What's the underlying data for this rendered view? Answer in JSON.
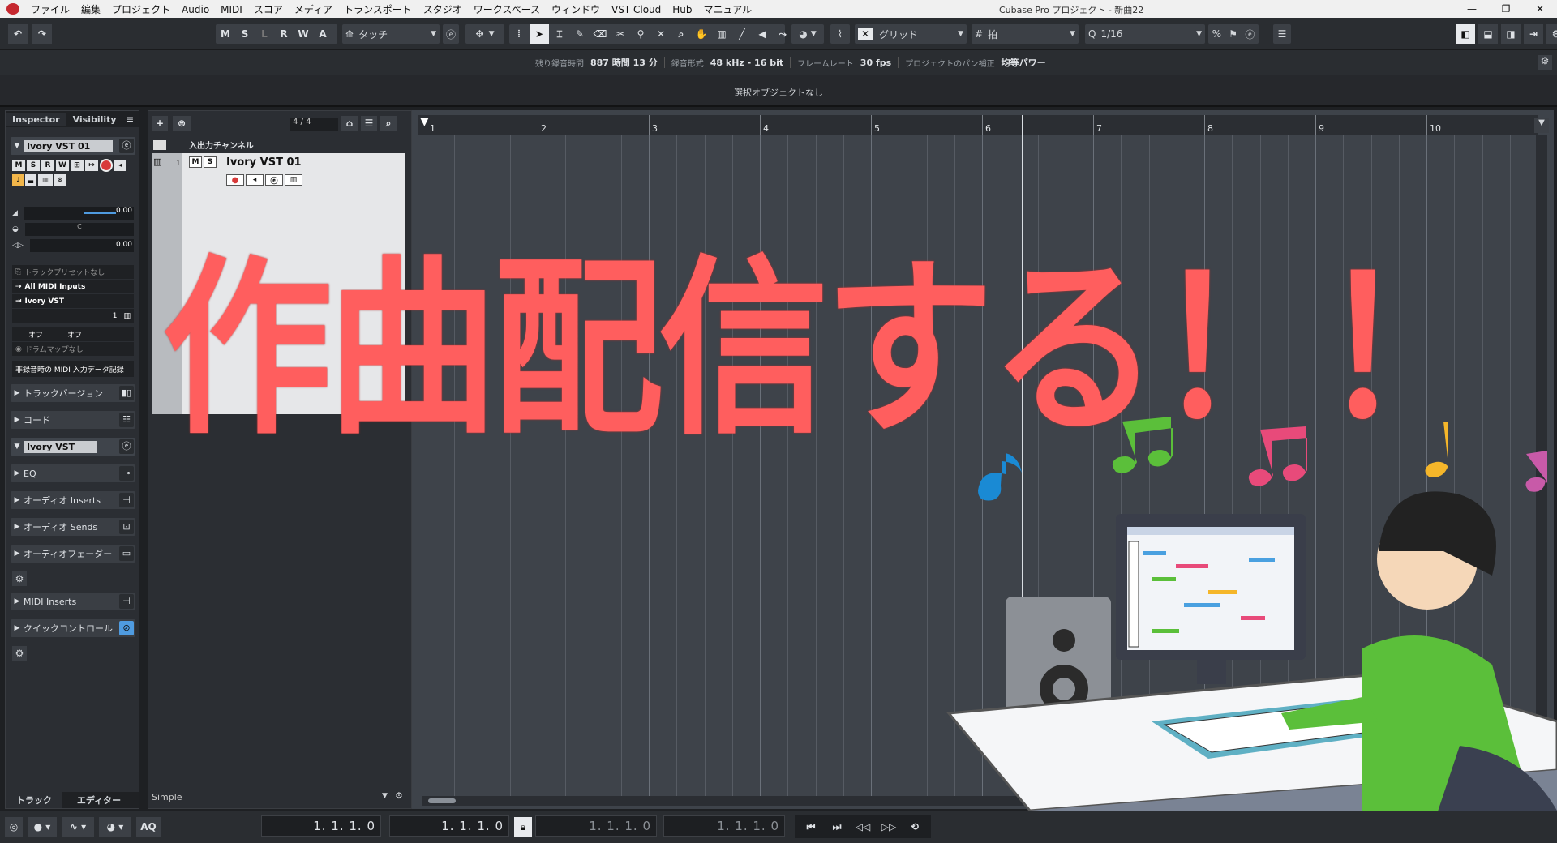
{
  "window": {
    "title": "Cubase Pro プロジェクト - 新曲22",
    "menu": [
      "ファイル",
      "編集",
      "プロジェクト",
      "Audio",
      "MIDI",
      "スコア",
      "メディア",
      "トランスポート",
      "スタジオ",
      "ワークスペース",
      "ウィンドウ",
      "VST Cloud",
      "Hub",
      "マニュアル"
    ]
  },
  "toolbar": {
    "mslrwa": [
      "M",
      "S",
      "L",
      "R",
      "W",
      "A"
    ],
    "automation_mode": "タッチ",
    "snap_type": "グリッド",
    "grid_type": "拍",
    "quantize": "1/16"
  },
  "info": {
    "rec_time_label": "残り録音時間",
    "rec_time_value": "887 時間 13 分",
    "rec_format_label": "録音形式",
    "rec_format_value": "48 kHz - 16 bit",
    "frame_rate_label": "フレームレート",
    "frame_rate_value": "30 fps",
    "pan_law_label": "プロジェクトのパン補正",
    "pan_law_value": "均等パワー"
  },
  "status": {
    "selection": "選択オブジェクトなし"
  },
  "inspector": {
    "tabs": [
      "Inspector",
      "Visibility"
    ],
    "track_name": "Ivory VST 01",
    "volume": "0.00",
    "pan": "C",
    "delay": "0.00",
    "preset": "トラックプリセットなし",
    "input": "All MIDI Inputs",
    "output": "Ivory VST",
    "channel": "1",
    "off1": "オフ",
    "off2": "オフ",
    "drummap": "ドラムマップなし",
    "record_mode": "非録音時の MIDI 入力データ記録",
    "sections": [
      "トラックバージョン",
      "コード"
    ],
    "instrument_name": "Ivory VST",
    "sections2": [
      "EQ",
      "オーディオ Inserts",
      "オーディオ Sends",
      "オーディオフェーダー"
    ],
    "sections3": [
      "MIDI Inserts",
      "クイックコントロール"
    ],
    "bottom_tabs": [
      "トラック",
      "エディター"
    ]
  },
  "tracklist": {
    "count": "4 / 4",
    "folder": "入出力チャンネル",
    "track_number": "1",
    "track_name": "Ivory VST 01",
    "footer": "Simple"
  },
  "ruler": {
    "bars": [
      "1",
      "2",
      "3",
      "4",
      "5",
      "6",
      "7",
      "8",
      "9",
      "10"
    ]
  },
  "transport": {
    "left_locator": "1. 1. 1.   0",
    "right_locator": "1. 1. 1.   0",
    "punch_in": "1. 1. 1.   0",
    "punch_out": "1. 1. 1.   0",
    "aq": "AQ"
  },
  "overlay": {
    "headline": "作曲配信する！！"
  },
  "colors": {
    "accent_red": "#ff5e5e",
    "cubase_red": "#c5282f",
    "selected_blue": "#4f9be0"
  }
}
